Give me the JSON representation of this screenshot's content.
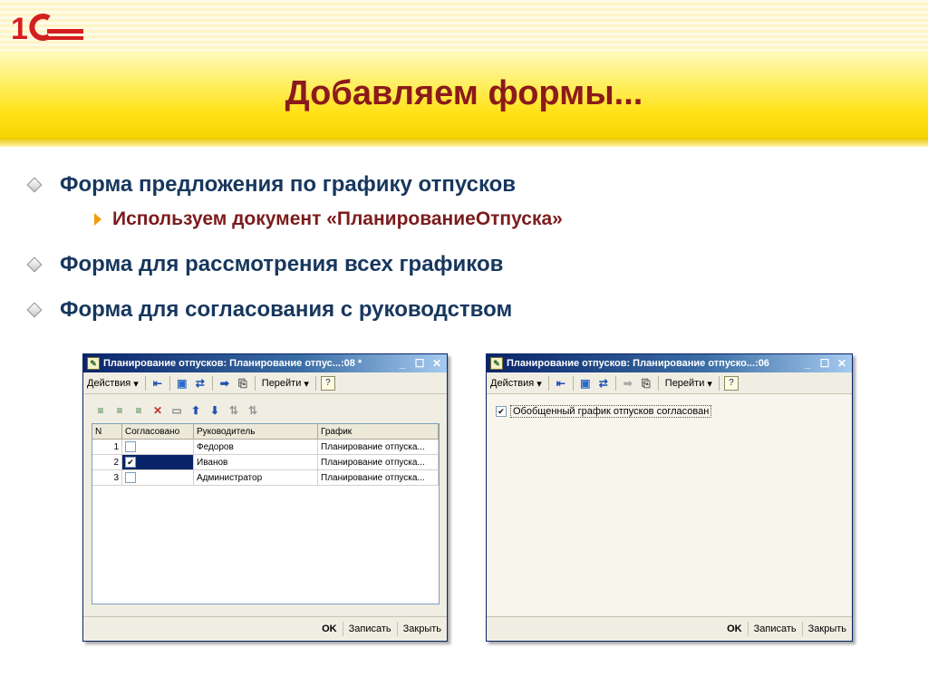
{
  "slide": {
    "logo_text": "1С",
    "title": "Добавляем формы...",
    "bullets": [
      "Форма предложения по графику отпусков",
      "Форма для рассмотрения всех графиков",
      "Форма для согласования с руководством"
    ],
    "sub_bullet": "Используем документ «ПланированиеОтпуска»"
  },
  "window1": {
    "title": "Планирование отпусков: Планирование отпус...:08 *",
    "toolbar": {
      "actions": "Действия",
      "goto": "Перейти",
      "help": "?"
    },
    "columns": [
      "N",
      "Согласовано",
      "Руководитель",
      "График"
    ],
    "rows": [
      {
        "n": "1",
        "checked": false,
        "manager": "Федоров",
        "schedule": "Планирование отпуска..."
      },
      {
        "n": "2",
        "checked": true,
        "manager": "Иванов",
        "schedule": "Планирование отпуска..."
      },
      {
        "n": "3",
        "checked": false,
        "manager": "Администратор",
        "schedule": "Планирование отпуска..."
      }
    ],
    "buttons": {
      "ok": "OK",
      "save": "Записать",
      "close": "Закрыть"
    }
  },
  "window2": {
    "title": "Планирование отпусков: Планирование отпуско...:06",
    "toolbar": {
      "actions": "Действия",
      "goto": "Перейти",
      "help": "?"
    },
    "checkbox_label": "Обобщенный график отпусков согласован",
    "checkbox_checked": true,
    "buttons": {
      "ok": "OK",
      "save": "Записать",
      "close": "Закрыть"
    }
  }
}
